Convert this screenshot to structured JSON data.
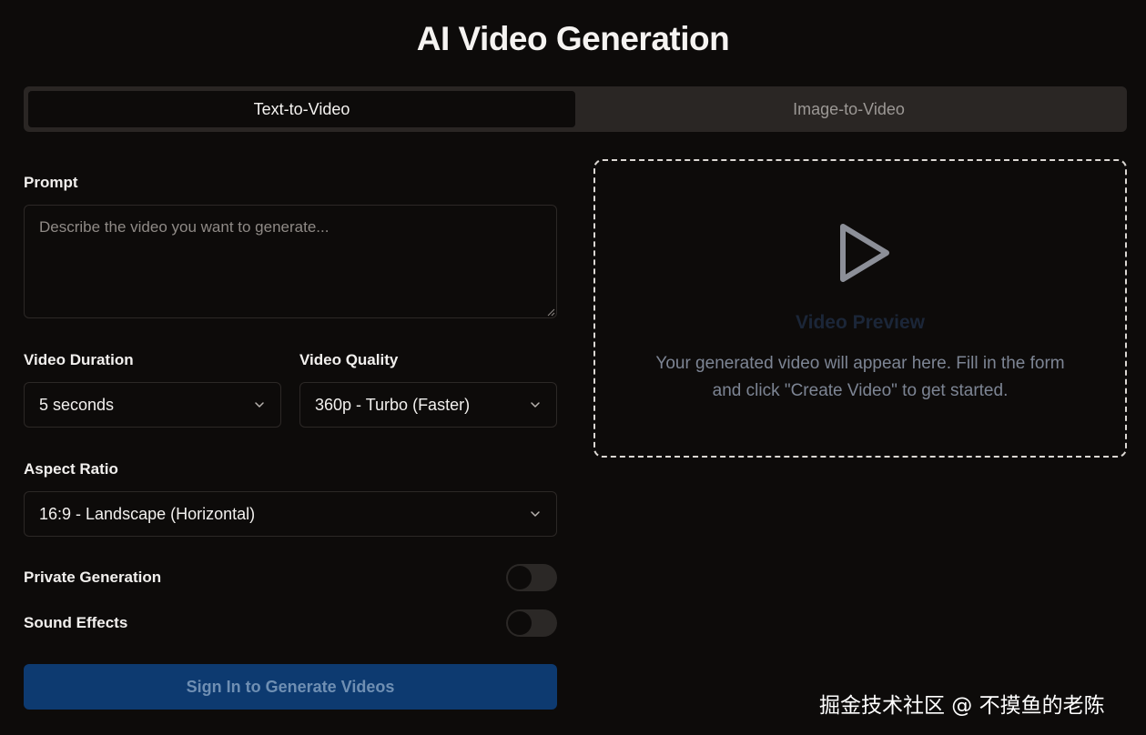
{
  "title": "AI Video Generation",
  "tabs": [
    {
      "label": "Text-to-Video",
      "active": true
    },
    {
      "label": "Image-to-Video",
      "active": false
    }
  ],
  "form": {
    "prompt_label": "Prompt",
    "prompt_placeholder": "Describe the video you want to generate...",
    "prompt_value": "",
    "duration_label": "Video Duration",
    "duration_value": "5 seconds",
    "quality_label": "Video Quality",
    "quality_value": "360p - Turbo (Faster)",
    "aspect_label": "Aspect Ratio",
    "aspect_value": "16:9 - Landscape (Horizontal)",
    "private_label": "Private Generation",
    "private_on": false,
    "sound_label": "Sound Effects",
    "sound_on": false,
    "submit_label": "Sign In to Generate Videos"
  },
  "preview": {
    "icon": "play-icon",
    "title": "Video Preview",
    "description": "Your generated video will appear here. Fill in the form and click \"Create Video\" to get started."
  },
  "watermark": "掘金技术社区 @ 不摸鱼的老陈",
  "colors": {
    "background": "#0d0b0a",
    "tab_bar": "#2a2624",
    "button": "#0d3a70",
    "button_text": "#6f8fb3",
    "preview_border": "#dcd8d4"
  }
}
